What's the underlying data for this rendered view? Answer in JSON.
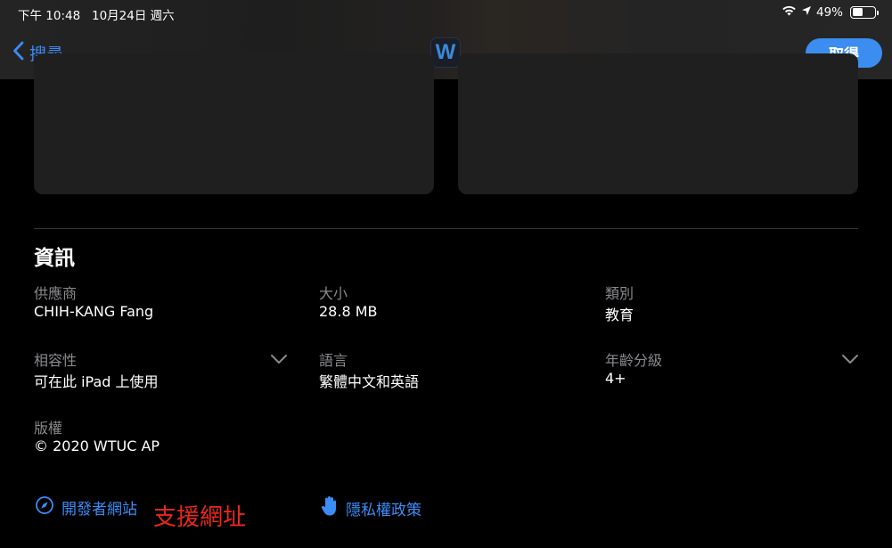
{
  "status_bar": {
    "time": "下午 10:48",
    "date": "10月24日 週六",
    "battery": "49%",
    "battery_level": 0.49
  },
  "nav": {
    "back_label": "搜尋",
    "app_icon_letter": "W",
    "get_label": "取得"
  },
  "info": {
    "title": "資訊",
    "items": [
      {
        "label": "供應商",
        "value": "CHIH-KANG Fang"
      },
      {
        "label": "大小",
        "value": "28.8 MB"
      },
      {
        "label": "類別",
        "value": "教育"
      },
      {
        "label": "相容性",
        "value": "可在此 iPad 上使用",
        "expandable": true
      },
      {
        "label": "語言",
        "value": "繁體中文和英語"
      },
      {
        "label": "年齡分級",
        "value": "4+",
        "expandable": true
      },
      {
        "label": "版權",
        "value": "© 2020 WTUC AP"
      }
    ]
  },
  "links": {
    "developer_website": "開發者網站",
    "privacy_policy": "隱私權政策"
  },
  "annotation": "支援網址",
  "colors": {
    "accent": "#3b8cf5",
    "annotation": "#e8281e",
    "background": "#000000",
    "card": "#1f1f1f",
    "label": "#8a8a8e"
  }
}
